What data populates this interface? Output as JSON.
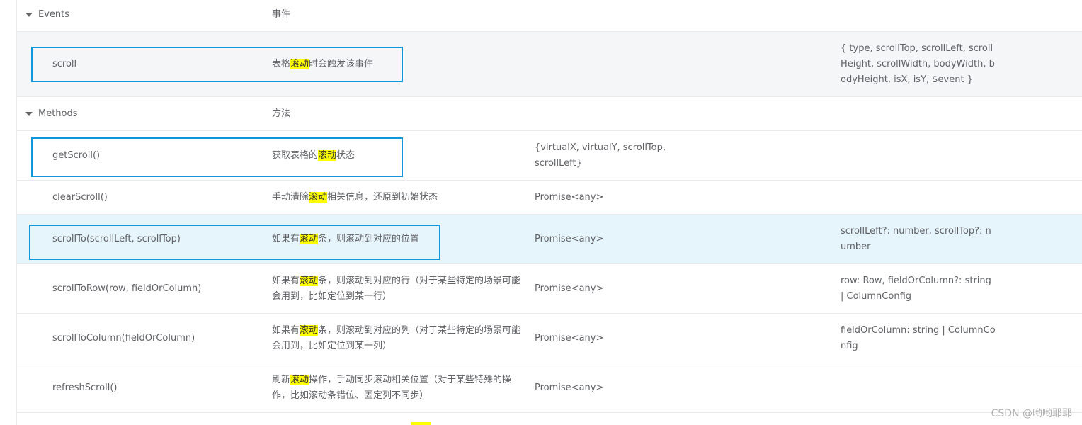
{
  "highlight_term": "滚动",
  "colors": {
    "accent_box": "#1296db",
    "highlight": "#ffff00",
    "row_highlight": "#e6f4fb"
  },
  "events_group": {
    "title": "Events",
    "desc": "事件"
  },
  "scroll_row": {
    "name": "scroll",
    "desc_pre": "表格",
    "desc_mark": "滚动",
    "desc_post": "时会触发该事件",
    "params": "{ type, scrollTop, scrollLeft, scrollHeight, scrollWidth, bodyWidth, bodyHeight, isX, isY, $event }"
  },
  "methods_group": {
    "title": "Methods",
    "desc": "方法"
  },
  "methods": [
    {
      "name": "getScroll()",
      "desc_pre": "获取表格的",
      "desc_mark": "滚动",
      "desc_post": "状态",
      "ret": "{virtualX, virtualY, scrollTop, scrollLeft}",
      "params": ""
    },
    {
      "name": "clearScroll()",
      "desc_pre": "手动清除",
      "desc_mark": "滚动",
      "desc_post": "相关信息，还原到初始状态",
      "ret": "Promise<any>",
      "params": ""
    },
    {
      "name": "scrollTo(scrollLeft, scrollTop)",
      "desc_pre": "如果有",
      "desc_mark": "滚动",
      "desc_post": "条，则滚动到对应的位置",
      "ret": "Promise<any>",
      "params": "scrollLeft?: number, scrollTop?: number"
    },
    {
      "name": "scrollToRow(row, fieldOrColumn)",
      "desc_pre": "如果有",
      "desc_mark": "滚动",
      "desc_post": "条，则滚动到对应的行（对于某些特定的场景可能会用到，比如定位到某一行）",
      "ret": "Promise<any>",
      "params": "row: Row, fieldOrColumn?: string | ColumnConfig"
    },
    {
      "name": "scrollToColumn(fieldOrColumn)",
      "desc_pre": "如果有",
      "desc_mark": "滚动",
      "desc_post": "条，则滚动到对应的列（对于某些特定的场景可能会用到，比如定位到某一列）",
      "ret": "Promise<any>",
      "params": "fieldOrColumn: string | ColumnConfig"
    },
    {
      "name": "refreshScroll()",
      "desc_pre": "刷新",
      "desc_mark": "滚动",
      "desc_post": "操作，手动同步滚动相关位置（对于某些特殊的操作，比如滚动条错位、固定列不同步）",
      "ret": "Promise<any>",
      "params": ""
    }
  ],
  "watermark": "CSDN @哟哟耶耶"
}
